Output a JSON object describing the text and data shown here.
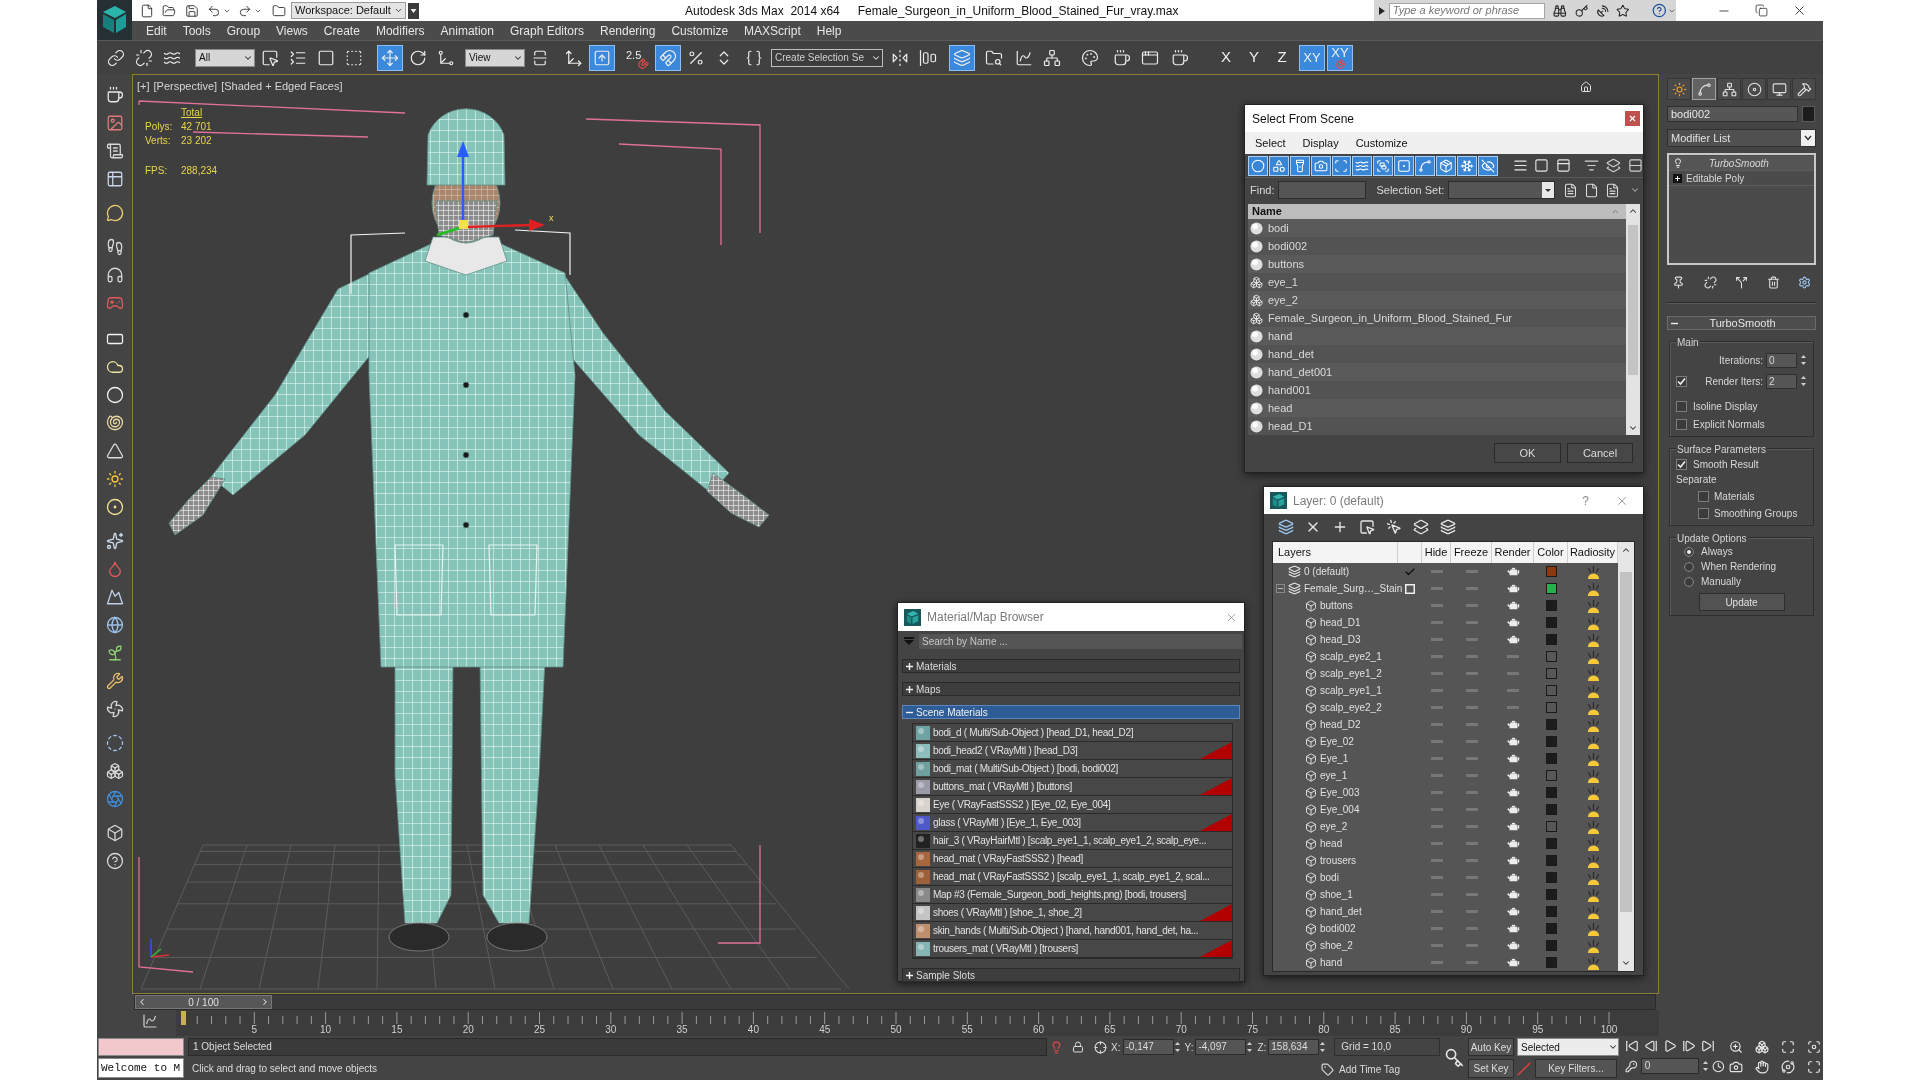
{
  "title_bar": {
    "workspace": "Workspace: Default",
    "app_title": "Autodesk 3ds Max  2014 x64",
    "file_title": "Female_Surgeon_in_Uniform_Blood_Stained_Fur_vray.max",
    "search_placeholder": "Type a keyword or phrase"
  },
  "menu": [
    "Edit",
    "Tools",
    "Group",
    "Views",
    "Create",
    "Modifiers",
    "Animation",
    "Graph Editors",
    "Rendering",
    "Customize",
    "MAXScript",
    "Help"
  ],
  "toolbar": [
    {
      "kind": "tool",
      "active": false
    },
    {
      "kind": "tool",
      "active": false
    },
    {
      "kind": "tool",
      "active": false
    },
    {
      "kind": "dropdown",
      "value": "All"
    },
    {
      "kind": "tool",
      "active": false
    },
    {
      "kind": "tool",
      "active": false
    },
    {
      "kind": "tool",
      "active": false
    },
    {
      "kind": "tool",
      "active": false
    },
    {
      "kind": "tool",
      "active": true
    },
    {
      "kind": "tool",
      "active": false
    },
    {
      "kind": "tool",
      "active": false
    },
    {
      "kind": "dropdown",
      "value": "View"
    },
    {
      "kind": "tool",
      "active": false
    },
    {
      "kind": "tool",
      "active": false
    },
    {
      "kind": "tool",
      "active": true
    },
    {
      "kind": "snap",
      "label": "2.5",
      "active": false
    },
    {
      "kind": "tool",
      "active": true
    },
    {
      "kind": "tool",
      "active": false
    },
    {
      "kind": "tool",
      "active": false
    },
    {
      "kind": "tool",
      "active": false
    },
    {
      "kind": "dropdown",
      "value": "Create Selection Se"
    },
    {
      "kind": "tool",
      "active": false
    },
    {
      "kind": "tool",
      "active": false
    },
    {
      "kind": "tool",
      "active": true
    },
    {
      "kind": "tool",
      "active": false
    },
    {
      "kind": "tool",
      "active": false
    },
    {
      "kind": "tool",
      "active": false
    },
    {
      "kind": "tool",
      "active": false
    },
    {
      "kind": "tool",
      "active": false
    },
    {
      "kind": "tool",
      "active": false
    },
    {
      "kind": "tool",
      "active": false
    },
    {
      "kind": "axis",
      "label": "X",
      "active": false
    },
    {
      "kind": "axis",
      "label": "Y",
      "active": false
    },
    {
      "kind": "axis",
      "label": "Z",
      "active": false
    },
    {
      "kind": "axis",
      "label": "XY",
      "active": true
    },
    {
      "kind": "axis_snap",
      "label": "XY",
      "active": true
    }
  ],
  "viewport": {
    "labels": [
      "[+]",
      "[Perspective]",
      "[Shaded + Edged Faces]"
    ],
    "stats": {
      "heading": "Total",
      "rows": [
        {
          "label": "Polys:",
          "value": "42 701"
        },
        {
          "label": "Verts:",
          "value": "23 202"
        }
      ],
      "fps": {
        "label": "FPS:",
        "value": "288,234"
      }
    },
    "gizmo_label": "x"
  },
  "select_from_scene": {
    "title": "Select From Scene",
    "menu": [
      "Select",
      "Display",
      "Customize"
    ],
    "filters": [
      {
        "active": true
      },
      {
        "active": true
      },
      {
        "active": true
      },
      {
        "active": true
      },
      {
        "active": true
      },
      {
        "active": true
      },
      {
        "active": true
      },
      {
        "active": true
      },
      {
        "active": true
      },
      {
        "active": true
      },
      {
        "active": true
      },
      {
        "active": true
      }
    ],
    "find_label": "Find:",
    "selection_set_label": "Selection Set:",
    "column": "Name",
    "rows": [
      {
        "name": "bodi",
        "kind": "geometry"
      },
      {
        "name": "bodi002",
        "kind": "geometry"
      },
      {
        "name": "buttons",
        "kind": "geometry"
      },
      {
        "name": "eye_1",
        "kind": "group"
      },
      {
        "name": "eye_2",
        "kind": "group"
      },
      {
        "name": "Female_Surgeon_in_Uniform_Blood_Stained_Fur",
        "kind": "group"
      },
      {
        "name": "hand",
        "kind": "geometry"
      },
      {
        "name": "hand_det",
        "kind": "geometry"
      },
      {
        "name": "hand_det001",
        "kind": "geometry"
      },
      {
        "name": "hand001",
        "kind": "geometry"
      },
      {
        "name": "head",
        "kind": "geometry"
      },
      {
        "name": "head_D1",
        "kind": "geometry"
      }
    ],
    "ok": "OK",
    "cancel": "Cancel"
  },
  "layer_dialog": {
    "title": "Layer: 0 (default)",
    "help": "?",
    "columns": [
      "Layers",
      "Hide",
      "Freeze",
      "Render",
      "Color",
      "Radiosity"
    ],
    "layers": [
      {
        "kind": "layer",
        "name": "0 (default)",
        "current": true,
        "render": true,
        "color": "#8b3a10"
      },
      {
        "kind": "layer",
        "name": "Female_Surg…_Stain",
        "current": false,
        "expanded": true,
        "render": true,
        "color": "#22b14c",
        "children": [
          {
            "kind": "object",
            "name": "buttons",
            "render": true,
            "color": "#1c1c1c"
          },
          {
            "kind": "object",
            "name": "head_D1",
            "render": true,
            "color": "#1c1c1c"
          },
          {
            "kind": "object",
            "name": "head_D3",
            "render": true,
            "color": "#1c1c1c"
          },
          {
            "kind": "object",
            "name": "scalp_eye2_1",
            "render": false,
            "color": "#575757"
          },
          {
            "kind": "object",
            "name": "scalp_eye1_2",
            "render": false,
            "color": "#575757"
          },
          {
            "kind": "object",
            "name": "scalp_eye1_1",
            "render": false,
            "color": "#575757"
          },
          {
            "kind": "object",
            "name": "scalp_eye2_2",
            "render": false,
            "color": "#575757"
          },
          {
            "kind": "object",
            "name": "head_D2",
            "render": true,
            "color": "#1c1c1c"
          },
          {
            "kind": "object",
            "name": "Eye_02",
            "render": true,
            "color": "#1c1c1c"
          },
          {
            "kind": "object",
            "name": "Eye_1",
            "render": true,
            "color": "#1c1c1c"
          },
          {
            "kind": "object",
            "name": "eye_1",
            "render": true,
            "color": "#575757"
          },
          {
            "kind": "object",
            "name": "Eye_003",
            "render": true,
            "color": "#1c1c1c"
          },
          {
            "kind": "object",
            "name": "Eye_004",
            "render": true,
            "color": "#1c1c1c"
          },
          {
            "kind": "object",
            "name": "eye_2",
            "render": true,
            "color": "#575757"
          },
          {
            "kind": "object",
            "name": "head",
            "render": true,
            "color": "#1c1c1c"
          },
          {
            "kind": "object",
            "name": "trousers",
            "render": true,
            "color": "#1c1c1c"
          },
          {
            "kind": "object",
            "name": "bodi",
            "render": true,
            "color": "#1c1c1c"
          },
          {
            "kind": "object",
            "name": "shoe_1",
            "render": true,
            "color": "#1c1c1c"
          },
          {
            "kind": "object",
            "name": "hand_det",
            "render": true,
            "color": "#1c1c1c"
          },
          {
            "kind": "object",
            "name": "bodi002",
            "render": true,
            "color": "#1c1c1c"
          },
          {
            "kind": "object",
            "name": "shoe_2",
            "render": true,
            "color": "#1c1c1c"
          },
          {
            "kind": "object",
            "name": "hand",
            "render": true,
            "color": "#1c1c1c"
          }
        ]
      }
    ]
  },
  "material_browser": {
    "title": "Material/Map Browser",
    "search_placeholder": "Search by Name ...",
    "groups": [
      {
        "label": "Materials",
        "expanded": false
      },
      {
        "label": "Maps",
        "expanded": false
      },
      {
        "label": "Scene Materials",
        "expanded": true,
        "items": [
          {
            "label": "bodi_d ( Multi/Sub-Object ) [head_D1, head_D2]",
            "color": "#6fa3a3",
            "marked": false
          },
          {
            "label": "bodi_head2 ( VRayMtl ) [head_D3]",
            "color": "#8fbcbc",
            "marked": true
          },
          {
            "label": "bodi_mat ( Multi/Sub-Object ) [bodi, bodi002]",
            "color": "#6f9f9f",
            "marked": false
          },
          {
            "label": "buttons_mat ( VRayMtl ) [buttons]",
            "color": "#9a9aa8",
            "marked": true
          },
          {
            "label": "Eye ( VRayFastSSS2 ) [Eye_02, Eye_004]",
            "color": "#d8d2cc",
            "marked": false
          },
          {
            "label": "glass ( VRayMtl ) [Eye_1, Eye_003]",
            "color": "#4f58c8",
            "marked": true
          },
          {
            "label": "hair_3 ( VRayHairMtl ) [scalp_eye1_1, scalp_eye1_2, scalp_eye...",
            "color": "#222222",
            "marked": false
          },
          {
            "label": "head_mat ( VRayFastSSS2 ) [head]",
            "color": "#a8663e",
            "marked": false
          },
          {
            "label": "head_mat ( VRayFastSSS2 ) [scalp_eye1_1, scalp_eye1_2, scal...",
            "color": "#9e6038",
            "marked": false
          },
          {
            "label": "Map #3 (Female_Surgeon_bodi_heights.png) [bodi, trousers]",
            "color": "#8a8a8a",
            "marked": false
          },
          {
            "label": "shoes ( VRayMtl ) [shoe_1, shoe_2]",
            "color": "#c4c4c4",
            "marked": true
          },
          {
            "label": "skin_hands ( Multi/Sub-Object ) [hand, hand001, hand_det, ha...",
            "color": "#c0906e",
            "marked": false
          },
          {
            "label": "trousers_mat ( VRayMtl ) [trousers]",
            "color": "#86b4b4",
            "marked": true
          }
        ]
      },
      {
        "label": "Sample Slots",
        "expanded": false
      }
    ]
  },
  "command_panel": {
    "tabs": [
      {
        "selected": false
      },
      {
        "selected": true
      },
      {
        "selected": false
      },
      {
        "selected": false
      },
      {
        "selected": false
      },
      {
        "selected": false
      }
    ],
    "object_name": "bodi002",
    "modifier_list": "Modifier List",
    "stack": [
      {
        "kind": "modifier",
        "label": "TurboSmooth"
      },
      {
        "kind": "base",
        "label": "Editable Poly"
      }
    ],
    "rollout": {
      "title": "TurboSmooth",
      "expanded": true,
      "main": {
        "label": "Main",
        "iterations": {
          "label": "Iterations:",
          "value": "0"
        },
        "render_iters": {
          "label": "Render Iters:",
          "value": "2",
          "checked": true
        },
        "options": [
          {
            "label": "Isoline Display",
            "checked": false
          },
          {
            "label": "Explicit Normals",
            "checked": false
          }
        ]
      },
      "surface": {
        "label": "Surface Parameters",
        "smooth_result": {
          "label": "Smooth Result",
          "checked": true
        },
        "separate": "Separate",
        "separate_options": [
          {
            "label": "Materials",
            "checked": false
          },
          {
            "label": "Smoothing Groups",
            "checked": false
          }
        ]
      },
      "update": {
        "label": "Update Options",
        "options": [
          {
            "label": "Always",
            "selected": true
          },
          {
            "label": "When Rendering",
            "selected": false
          },
          {
            "label": "Manually",
            "selected": false
          }
        ],
        "button": "Update"
      }
    }
  },
  "time_slider": {
    "label": "0 / 100",
    "level": 0
  },
  "track_bar": {
    "labels": [
      "5",
      "10",
      "15",
      "20",
      "25",
      "30",
      "35",
      "40",
      "45",
      "50",
      "55",
      "60",
      "65",
      "70",
      "75",
      "80",
      "85",
      "90",
      "95",
      "100"
    ]
  },
  "status_bar": {
    "listener": "Welcome to M",
    "selection": "1 Object Selected",
    "prompt": "Click and drag to select and move objects",
    "coords": [
      {
        "axis": "X:",
        "value": "-0,147"
      },
      {
        "axis": "Y:",
        "value": "-4,097"
      },
      {
        "axis": "Z:",
        "value": "158,634"
      }
    ],
    "grid": "Grid = 10,0",
    "time_tag": "Add Time Tag",
    "auto_key": "Auto Key",
    "set_key": "Set Key",
    "key_mode": "Selected",
    "key_filters": "Key Filters...",
    "frame": "0"
  }
}
